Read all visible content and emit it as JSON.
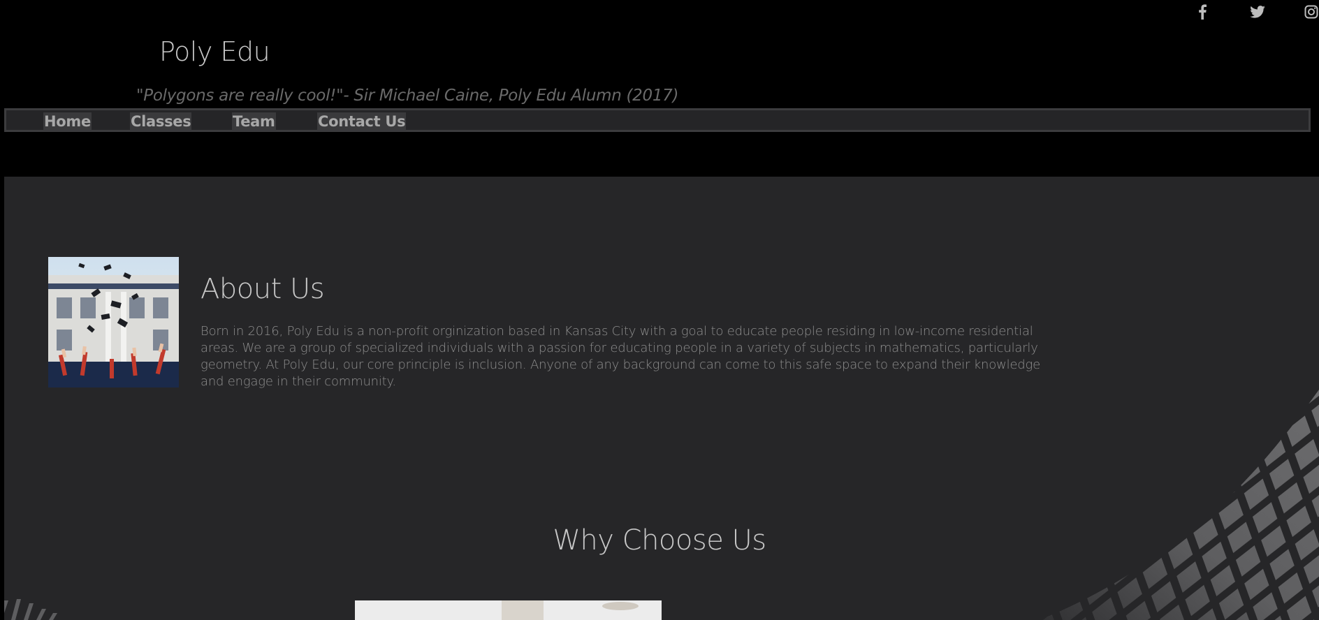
{
  "header": {
    "site_title": "Poly Edu",
    "quote": "\"Polygons are really cool!\"- Sir Michael Caine, Poly Edu Alumn (2017)",
    "socials": [
      "facebook-icon",
      "twitter-icon",
      "instagram-icon"
    ]
  },
  "nav": {
    "items": [
      {
        "label": "Home"
      },
      {
        "label": "Classes"
      },
      {
        "label": "Team"
      },
      {
        "label": "Contact Us"
      }
    ]
  },
  "about": {
    "heading": "About Us",
    "body": "Born in 2016, Poly Edu is a non-profit orginization based in Kansas City with a goal to educate people residing in low-income residential areas. We are a group of specialized individuals with a passion for educating people in a variety of subjects in mathematics, particularly geometry. At Poly Edu, our core principle is inclusion. Anyone of any background can come to this safe space to expand their knowledge and engage in their community.",
    "image": "graduation-caps-photo"
  },
  "why": {
    "heading": "Why Choose Us",
    "image": "feature-photo"
  },
  "colors": {
    "page_background": "#000000",
    "section_background": "#262628",
    "nav_background": "#252527",
    "nav_item_background": "#3a3a3c",
    "text_primary": "#c8c8c8",
    "text_muted": "#8e8e8e"
  }
}
